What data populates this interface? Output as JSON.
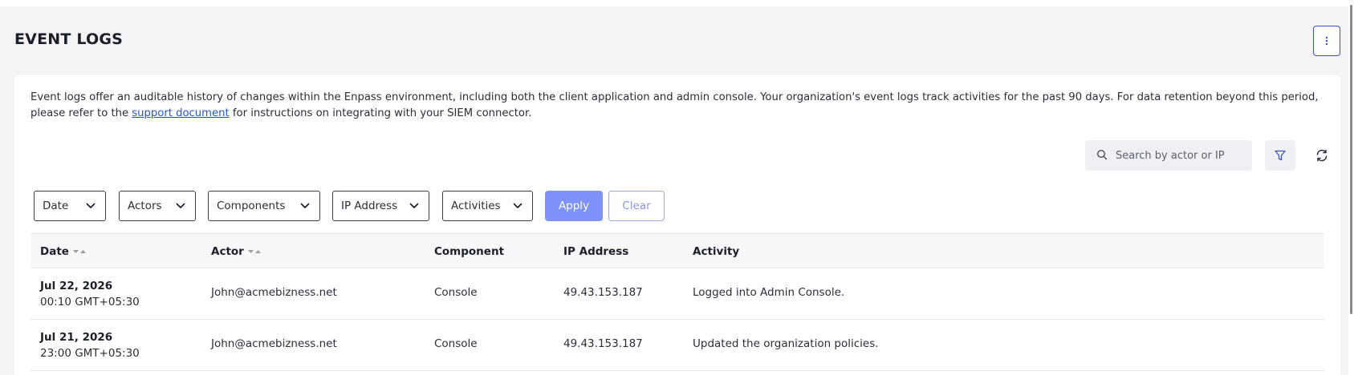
{
  "page": {
    "title": "EVENT LOGS"
  },
  "description": {
    "before_link": "Event logs offer an auditable history of changes within the Enpass environment, including both the client application and admin console. Your organization's event logs track activities for the past 90 days. For data retention beyond this period, please refer to the ",
    "link_text": "support document",
    "after_link": " for instructions on integrating with your SIEM connector."
  },
  "search": {
    "placeholder": "Search by actor or IP",
    "value": ""
  },
  "filters": {
    "date": "Date",
    "actors": "Actors",
    "components": "Components",
    "ip_address": "IP Address",
    "activities": "Activities",
    "apply": "Apply",
    "clear": "Clear"
  },
  "table": {
    "headers": {
      "date": "Date",
      "actor": "Actor",
      "component": "Component",
      "ip": "IP Address",
      "activity": "Activity"
    },
    "rows": [
      {
        "date": "Jul 22, 2026",
        "time": "00:10 GMT+05:30",
        "actor": "John@acmebizness.net",
        "component": "Console",
        "ip": "49.43.153.187",
        "activity": "Logged into Admin Console."
      },
      {
        "date": "Jul 21, 2026",
        "time": "23:00 GMT+05:30",
        "actor": "John@acmebizness.net",
        "component": "Console",
        "ip": "49.43.153.187",
        "activity": "Updated the organization policies."
      }
    ]
  },
  "colors": {
    "accent": "#3c4fd0",
    "apply_bg": "#7f92fb",
    "link": "#2457d6"
  },
  "icons": [
    "more-vertical-icon",
    "search-icon",
    "filter-icon",
    "refresh-icon",
    "chevron-down-icon",
    "sort-icon"
  ]
}
